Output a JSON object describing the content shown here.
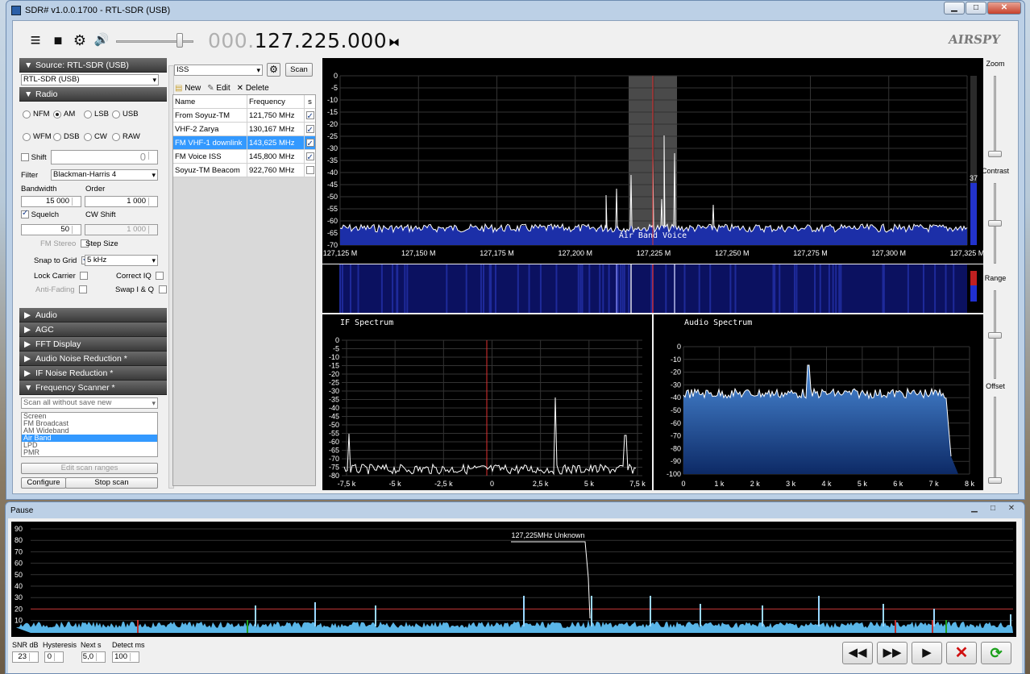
{
  "window": {
    "title": "SDR# v1.0.0.1700 - RTL-SDR (USB)",
    "min": "▁",
    "max": "□",
    "close": "✕"
  },
  "toolbar": {
    "menu_icon": "≡",
    "stop_icon": "■",
    "gear_icon": "⚙",
    "speaker_icon": "🔊",
    "freq_dim": "000.",
    "freq_main": "127.225.000",
    "tuning_icon": "⧓",
    "logo": "AIRSPY"
  },
  "left": {
    "source_header": "Source: RTL-SDR (USB)",
    "source_value": "RTL-SDR (USB)",
    "radio_header": "Radio",
    "modes": [
      {
        "label": "NFM",
        "on": false
      },
      {
        "label": "AM",
        "on": true
      },
      {
        "label": "LSB",
        "on": false
      },
      {
        "label": "USB",
        "on": false
      },
      {
        "label": "WFM",
        "on": false
      },
      {
        "label": "DSB",
        "on": false
      },
      {
        "label": "CW",
        "on": false
      },
      {
        "label": "RAW",
        "on": false
      }
    ],
    "shift_label": "Shift",
    "shift_value": "0",
    "filter_label": "Filter",
    "filter_value": "Blackman-Harris 4",
    "bandwidth_label": "Bandwidth",
    "bandwidth_value": "15 000",
    "order_label": "Order",
    "order_value": "1 000",
    "squelch_label": "Squelch",
    "squelch_value": "50",
    "cwshift_label": "CW Shift",
    "cwshift_value": "1 000",
    "fmstereo_label": "FM Stereo",
    "stepsize_label": "Step Size",
    "snap_label": "Snap to Grid",
    "snap_value": "5 kHz",
    "lockcarrier_label": "Lock Carrier",
    "correctiq_label": "Correct IQ",
    "antifading_label": "Anti-Fading",
    "swapiq_label": "Swap I & Q",
    "sections": [
      "Audio",
      "AGC",
      "FFT Display",
      "Audio Noise Reduction *",
      "IF Noise Reduction *"
    ],
    "scanner_header": "Frequency Scanner *",
    "scan_mode": "Scan all without save new",
    "scan_list": [
      "Screen",
      "FM Broadcast",
      "AM Wideband",
      "Air Band",
      "LPD",
      "PMR"
    ],
    "edit_ranges": "Edit scan ranges",
    "configure": "Configure",
    "stop_scan": "Stop scan"
  },
  "fm": {
    "group": "ISS",
    "scan": "Scan",
    "new": "New",
    "edit": "Edit",
    "delete": "Delete",
    "cols": [
      "Name",
      "Frequency",
      "s"
    ],
    "rows": [
      {
        "name": "From Soyuz-TM",
        "freq": "121,750 MHz",
        "checked": true,
        "hl": false
      },
      {
        "name": "VHF-2 Zarya",
        "freq": "130,167 MHz",
        "checked": true,
        "hl": false
      },
      {
        "name": "FM VHF-1 downlink",
        "freq": "143,625 MHz",
        "checked": true,
        "hl": true
      },
      {
        "name": "FM Voice ISS",
        "freq": "145,800 MHz",
        "checked": true,
        "hl": false
      },
      {
        "name": "Soyuz-TM Beacom",
        "freq": "922,760 MHz",
        "checked": false,
        "hl": false
      }
    ]
  },
  "main_spectrum": {
    "y_ticks": [
      "0",
      "-5",
      "-10",
      "-15",
      "-20",
      "-25",
      "-30",
      "-35",
      "-40",
      "-45",
      "-50",
      "-55",
      "-60",
      "-65",
      "-70"
    ],
    "x_ticks": [
      "127,125 M",
      "127,150 M",
      "127,175 M",
      "127,200 M",
      "127,225 M",
      "127,250 M",
      "127,275 M",
      "127,300 M",
      "127,325 M"
    ],
    "band_label": "Air Band Voice",
    "level": "37"
  },
  "if_spectrum": {
    "title": "IF Spectrum",
    "y_ticks": [
      "0",
      "-5",
      "-10",
      "-15",
      "-20",
      "-25",
      "-30",
      "-35",
      "-40",
      "-45",
      "-50",
      "-55",
      "-60",
      "-65",
      "-70",
      "-75",
      "-80"
    ],
    "x_ticks": [
      "-7,5 k",
      "-5 k",
      "-2,5 k",
      "0",
      "2,5 k",
      "5 k",
      "7,5 k"
    ]
  },
  "audio_spectrum": {
    "title": "Audio Spectrum",
    "y_ticks": [
      "0",
      "-10",
      "-20",
      "-30",
      "-40",
      "-50",
      "-60",
      "-70",
      "-80",
      "-90",
      "-100"
    ],
    "x_ticks": [
      "0",
      "1 k",
      "2 k",
      "3 k",
      "4 k",
      "5 k",
      "6 k",
      "7 k",
      "8 k"
    ]
  },
  "side": {
    "zoom": "Zoom",
    "contrast": "Contrast",
    "range": "Range",
    "offset": "Offset"
  },
  "scanner": {
    "title": "Pause",
    "y_ticks": [
      "90",
      "80",
      "70",
      "60",
      "50",
      "40",
      "30",
      "20",
      "10"
    ],
    "peak_label": "127,225MHz Unknown",
    "snr_label": "SNR dB",
    "snr_value": "23",
    "hyst_label": "Hysteresis",
    "hyst_value": "0",
    "next_label": "Next s",
    "next_value": "5,0",
    "detect_label": "Detect ms",
    "detect_value": "100",
    "btn_back": "◀◀",
    "btn_fwd": "▶▶",
    "btn_play": "▶",
    "btn_stop": "✕",
    "btn_refresh": "⟳"
  }
}
